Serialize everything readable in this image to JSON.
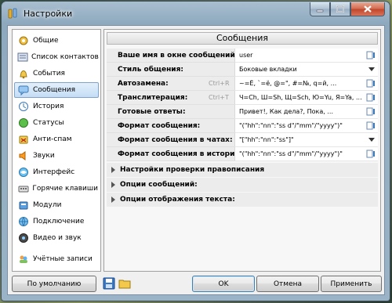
{
  "window": {
    "title": "Настройки"
  },
  "sidebar": {
    "items": [
      {
        "label": "Общие",
        "icon": "gear-wheel-icon"
      },
      {
        "label": "Список контактов",
        "icon": "contact-list-icon"
      },
      {
        "label": "События",
        "icon": "bell-icon"
      },
      {
        "label": "Сообщения",
        "icon": "message-bubble-icon"
      },
      {
        "label": "История",
        "icon": "history-icon"
      },
      {
        "label": "Статусы",
        "icon": "status-icon"
      },
      {
        "label": "Анти-спам",
        "icon": "anti-spam-icon"
      },
      {
        "label": "Звуки",
        "icon": "speaker-icon"
      },
      {
        "label": "Интерфейс",
        "icon": "interface-icon"
      },
      {
        "label": "Горячие клавиши",
        "icon": "keyboard-icon"
      },
      {
        "label": "Модули",
        "icon": "plugin-icon"
      },
      {
        "label": "Подключение",
        "icon": "connection-icon"
      },
      {
        "label": "Видео и звук",
        "icon": "video-icon"
      },
      {
        "label": "Учётные записи",
        "icon": "accounts-icon"
      }
    ]
  },
  "main": {
    "title": "Сообщения",
    "rows": [
      {
        "label": "Ваше имя в окне сообщений:",
        "hint": "",
        "value": "user",
        "control": "edit"
      },
      {
        "label": "Стиль общения:",
        "hint": "",
        "value": "Боковые вкладки",
        "control": "dropdown"
      },
      {
        "label": "Автозамена:",
        "hint": "Ctrl+R",
        "value": "~=Ё, `=ё, @=\", #=№, q=й, ...",
        "control": "edit"
      },
      {
        "label": "Транслитерация:",
        "hint": "Ctrl+T",
        "value": "Ч=Ch, Ш=Sh, Щ=Sch, Ю=Yu, Я=Ya, ...",
        "control": "edit"
      },
      {
        "label": "Готовые ответы:",
        "hint": "",
        "value": "Привет!, Как дела?, Пока, ...",
        "control": "edit"
      },
      {
        "label": "Формат сообщения:",
        "hint": "",
        "value": "\"(\"hh\":\"nn\":\"ss d\"/\"mm\"/\"yyyy\")\"",
        "control": "edit"
      },
      {
        "label": "Формат сообщения в чатах:",
        "hint": "",
        "value": "\"[\"hh\":\"nn\":\"ss\"]\"",
        "control": "dropdown"
      },
      {
        "label": "Формат сообщения в истории:",
        "hint": "",
        "value": "\"(\"hh\":\"nn\":\"ss d\"/\"mm\"/\"yyyy\")\"",
        "control": "edit"
      }
    ],
    "groups": [
      {
        "label": "Настройки проверки правописания"
      },
      {
        "label": "Опции сообщений:"
      },
      {
        "label": "Опции отображения текста:"
      }
    ]
  },
  "buttons": {
    "defaults": "По умолчанию",
    "ok": "OK",
    "cancel": "Отмена",
    "apply": "Применить"
  },
  "colors": {
    "selection": "#c4ddf5",
    "close_button": "#c0452a"
  }
}
